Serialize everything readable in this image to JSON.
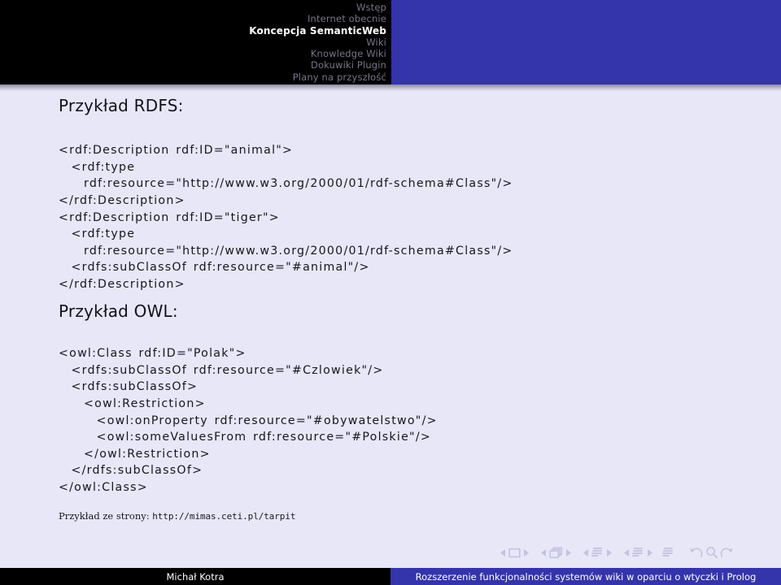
{
  "header": {
    "nav_items": [
      {
        "label": "Wstęp",
        "active": false
      },
      {
        "label": "Internet obecnie",
        "active": false
      },
      {
        "label": "Koncepcja SemanticWeb",
        "active": true
      },
      {
        "label": "Wiki",
        "active": false
      },
      {
        "label": "Knowledge Wiki",
        "active": false
      },
      {
        "label": "Dokuwiki Plugin",
        "active": false
      },
      {
        "label": "Plany na przyszłość",
        "active": false
      }
    ],
    "bar_color": "#3434ab",
    "background_color": "#000000"
  },
  "slide": {
    "rdfs_title": "Przykład RDFS:",
    "rdfs_code": "<rdf:Description rdf:ID=\"animal\">\n  <rdf:type\n    rdf:resource=\"http://www.w3.org/2000/01/rdf-schema#Class\"/>\n</rdf:Description>\n<rdf:Description rdf:ID=\"tiger\">\n  <rdf:type\n    rdf:resource=\"http://www.w3.org/2000/01/rdf-schema#Class\"/>\n  <rdfs:subClassOf rdf:resource=\"#animal\"/>\n</rdf:Description>",
    "owl_title": "Przykład OWL:",
    "owl_code": "<owl:Class rdf:ID=\"Polak\">\n  <rdfs:subClassOf rdf:resource=\"#Czlowiek\"/>\n  <rdfs:subClassOf>\n    <owl:Restriction>\n      <owl:onProperty rdf:resource=\"#obywatelstwo\"/>\n      <owl:someValuesFrom rdf:resource=\"#Polskie\"/>\n    </owl:Restriction>\n  </rdfs:subClassOf>\n</owl:Class>",
    "source_label": "Przykład ze strony:",
    "source_url": "http://mimas.ceti.pl/tarpit",
    "background_color": "#e7e7f8"
  },
  "navigation_symbols": {
    "slide_prev": "prev-slide-icon",
    "slide_marker": "slide-icon",
    "slide_next": "next-slide-icon",
    "frame_prev": "prev-frame-icon",
    "frame_marker": "frame-icon",
    "frame_next": "next-frame-icon",
    "subsection_prev": "prev-subsection-icon",
    "subsection_marker": "subsection-icon",
    "subsection_next": "next-subsection-icon",
    "section_prev": "prev-section-icon",
    "section_marker": "section-icon",
    "section_next": "next-section-icon",
    "presentation_marker": "presentation-icon",
    "back": "back-icon",
    "find": "find-icon",
    "forward": "forward-icon",
    "color": "#c3c3e0"
  },
  "footer": {
    "author": "Michał Kotra",
    "title": "Rozszerzenie funkcjonalności systemów wiki w oparciu o wtyczki i Prolog",
    "author_bg": "#000000",
    "title_bg": "#3434ab"
  }
}
